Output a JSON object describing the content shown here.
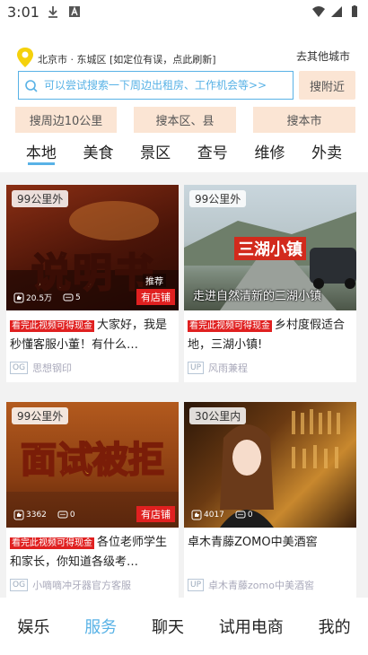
{
  "status": {
    "time": "3:01"
  },
  "location": {
    "text": "北京市 · 东城区 [如定位有误，点此刷新]",
    "other_city": "去其他城市"
  },
  "search": {
    "placeholder": "可以尝试搜索一下周边出租房、工作机会等>>",
    "nearby_label": "搜附近"
  },
  "quick": [
    "搜周边10公里",
    "搜本区、县",
    "搜本市"
  ],
  "tabs": [
    {
      "label": "本地",
      "active": true
    },
    {
      "label": "美食"
    },
    {
      "label": "景区"
    },
    {
      "label": "查号"
    },
    {
      "label": "维修"
    },
    {
      "label": "外卖"
    }
  ],
  "cards": [
    {
      "distance": "99公里外",
      "image_text": "说明书",
      "overlay_tag": "推荐",
      "likes": "20.5万",
      "comments": "5",
      "shop": "有店铺",
      "promo": "看完此视频可得现金",
      "title": "大家好，我是秒懂客服小董！有什么…",
      "author_tag": "OG",
      "author": "思想钢印"
    },
    {
      "distance": "99公里外",
      "image_text": "三湖小镇",
      "caption": "走进自然清新的三湖小镇",
      "promo": "看完此视频可得现金",
      "title": "乡村度假适合地，三湖小镇!",
      "author_tag": "UP",
      "author": "风雨兼程"
    },
    {
      "distance": "99公里外",
      "image_text": "面试被拒",
      "likes": "3362",
      "comments": "0",
      "shop": "有店铺",
      "promo": "看完此视频可得现金",
      "title": "各位老师学生和家长，你知道各级考…",
      "author_tag": "OG",
      "author": "小嘀嘀冲牙器官方客服"
    },
    {
      "distance": "30公里内",
      "likes": "4017",
      "comments": "0",
      "title": "卓木青藤ZOMO中美酒窖",
      "author_tag": "UP",
      "author": "卓木青藤zomo中美酒窖"
    }
  ],
  "bottom_nav": [
    {
      "label": "娱乐"
    },
    {
      "label": "服务",
      "active": true
    },
    {
      "label": "聊天"
    },
    {
      "label": "试用电商"
    },
    {
      "label": "我的"
    }
  ],
  "colors": {
    "accent": "#58b2e6",
    "peach": "#fbe5d4",
    "promo_red": "#e02020"
  }
}
